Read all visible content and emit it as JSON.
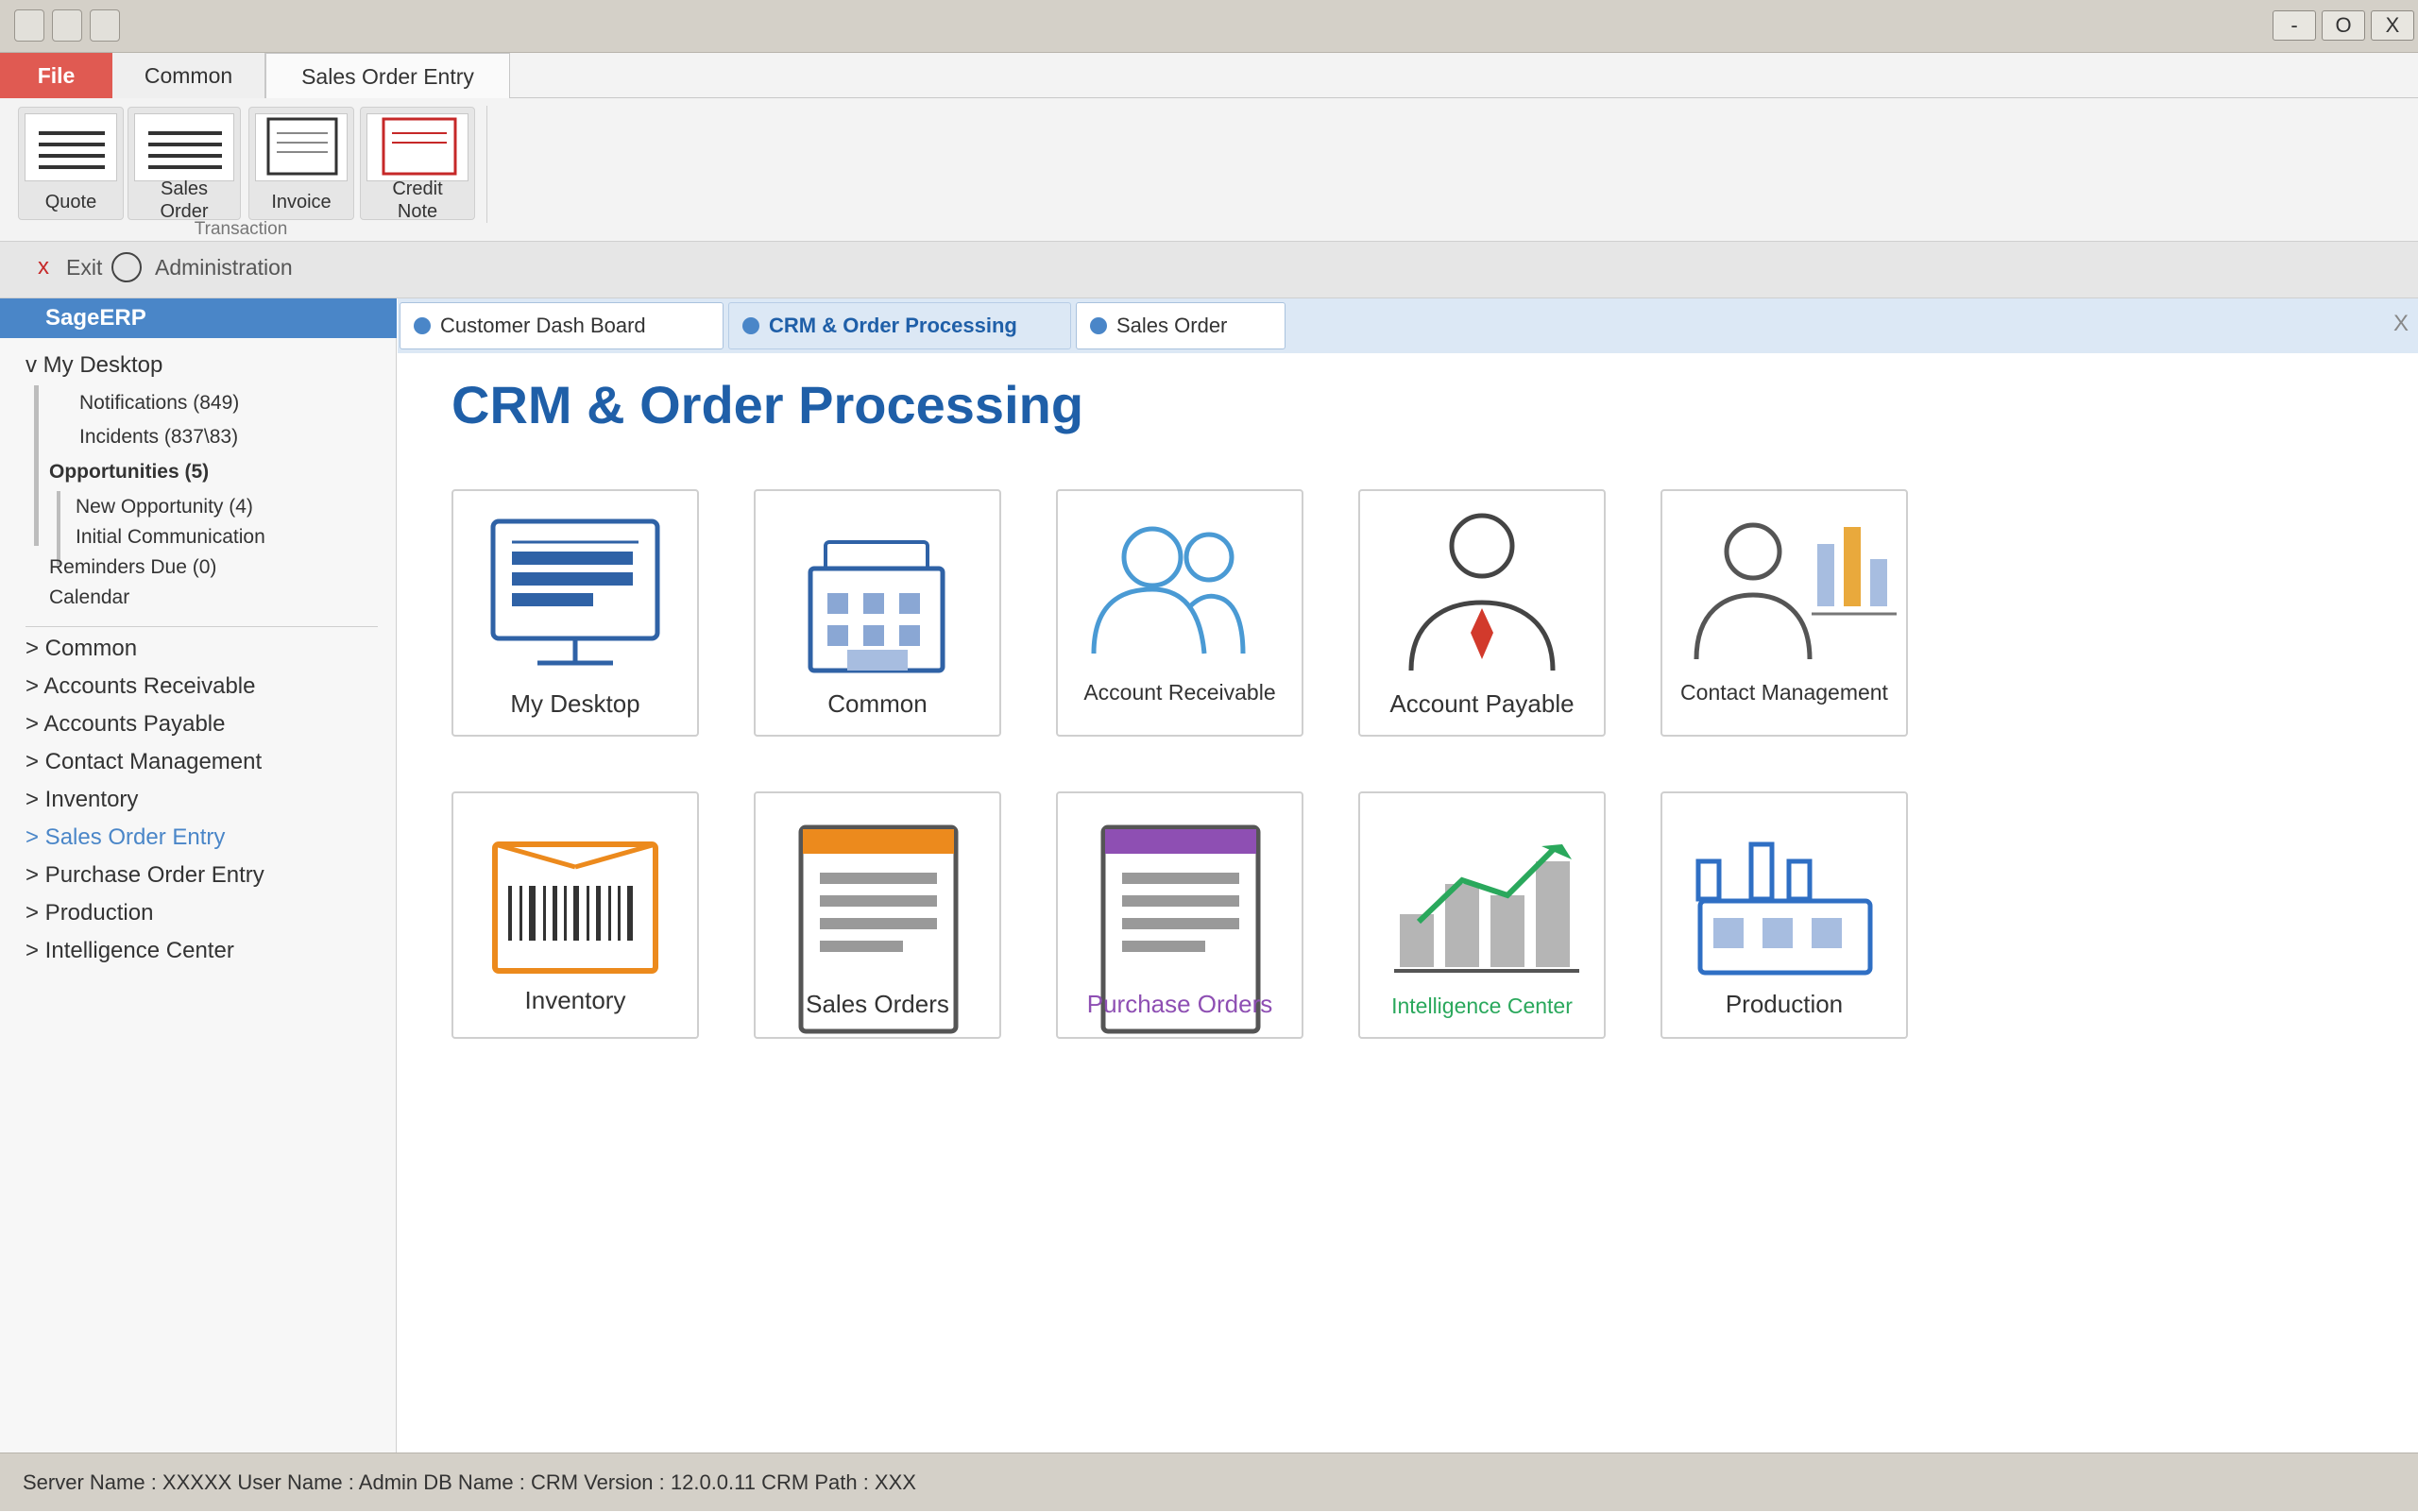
{
  "window": {
    "minimize_label": "-",
    "maximize_label": "O",
    "close_label": "X"
  },
  "menu": {
    "tabs": [
      "File",
      "Common",
      "Sales Order Entry"
    ]
  },
  "ribbon": {
    "buttons": [
      {
        "label": "Quote",
        "icon": "quote-icon"
      },
      {
        "label": "Sales\nOrder",
        "icon": "sales-order-icon"
      },
      {
        "label": "Invoice",
        "icon": "invoice-icon"
      },
      {
        "label": "Credit\nNote",
        "icon": "credit-note-icon"
      }
    ],
    "group_label": "Transaction"
  },
  "toolrow": {
    "exit_mark": "x",
    "exit_label": "Exit",
    "admin_label": "Administration"
  },
  "sidebar": {
    "header": "SageERP",
    "my_desktop": "v My Desktop",
    "notifications": "Notifications (849)",
    "incidents": "Incidents (837\\83)",
    "opportunities": "Opportunities (5)",
    "new_opportunity": "New Opportunity (4)",
    "initial_communication": "Initial Communication",
    "reminders": "Reminders Due (0)",
    "calendar": "Calendar",
    "sections": [
      "> Common",
      "> Accounts Receivable",
      "> Accounts Payable",
      "> Contact Management",
      "> Inventory",
      "> Sales Order Entry",
      "> Purchase Order Entry",
      "> Production",
      "> Intelligence Center"
    ],
    "highlight_color": "#4a86c8"
  },
  "content": {
    "tabs": [
      "Customer Dash Board",
      "CRM & Order Processing",
      "Sales Order"
    ],
    "active_tab": "CRM & Order Processing",
    "close_label": "X",
    "title": "CRM & Order Processing",
    "tiles": [
      {
        "label": "My Desktop",
        "icon": "monitor-icon"
      },
      {
        "label": "Common",
        "icon": "building-icon"
      },
      {
        "label": "Account Receivable",
        "icon": "users-icon"
      },
      {
        "label": "Account Payable",
        "icon": "businessman-icon"
      },
      {
        "label": "Contact Management",
        "icon": "contact-chart-icon"
      },
      {
        "label": "Inventory",
        "icon": "barcode-box-icon"
      },
      {
        "label": "Sales Orders",
        "icon": "sales-orders-doc-icon"
      },
      {
        "label": "Purchase Orders",
        "icon": "purchase-orders-doc-icon"
      },
      {
        "label": "Intelligence Center",
        "icon": "growth-chart-icon"
      },
      {
        "label": "Production",
        "icon": "factory-icon"
      }
    ]
  },
  "status": {
    "text": "Server Name : XXXXX User Name : Admin DB Name : CRM Version : 12.0.0.11 CRM Path : XXX"
  },
  "colors": {
    "accent": "#4a86c8",
    "title_blue": "#1f5fa8",
    "file_red": "#e05a52",
    "orange": "#ec8a1d",
    "purple": "#8e4fb3",
    "green": "#2aa85c"
  }
}
